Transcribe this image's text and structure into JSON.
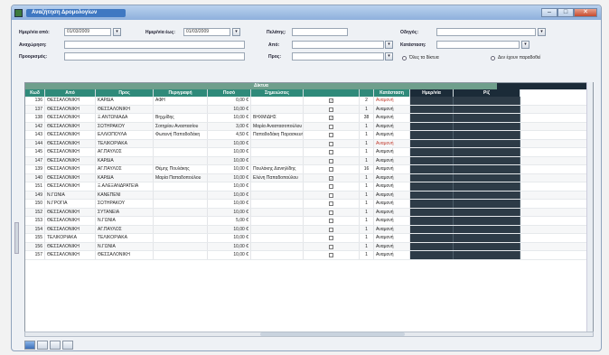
{
  "window": {
    "title": "Αναζήτηση Δρομολογίων",
    "buttons": [
      "–",
      "□",
      "✕"
    ]
  },
  "form": {
    "date_from_label": "Ημερ/νία από:",
    "date_from": "01/03/2009",
    "date_to_label": "Ημερ/νία έως:",
    "date_to": "01/03/2009",
    "departure_label": "Αναχώρηση:",
    "departure": "",
    "destination_label": "Προορισμός:",
    "destination": "",
    "client_label": "Πελάτης:",
    "client": "",
    "from_label": "Από:",
    "from": "",
    "to_label": "Προς:",
    "to": "",
    "driver_label": "Οδηγός:",
    "driver": "",
    "category_label": "Κατάσταση:",
    "category": "",
    "radio_all": "Όλες τα δίκτυα",
    "radio_other": "Δεν έχουν παραδοθεί"
  },
  "grid": {
    "group_title": "Δίκτυα",
    "columns": [
      "Κωδ",
      "Από",
      "Προς",
      "Περιγραφή",
      "Ποσό",
      "Σημειώσεις",
      "",
      "",
      "Κατάσταση",
      "Ημερ/νία",
      "Ρίζ"
    ],
    "rows": [
      {
        "id": "136",
        "from": "ΘΕΣΣΑΛΟΝΙΚΗ",
        "to": "ΚΑΡΔΙΑ",
        "desc": "ΑΦΗ",
        "amt": "0,00 €",
        "note": "",
        "chk": true,
        "qty": "2",
        "status": "Αναμονή",
        "red": true
      },
      {
        "id": "137",
        "from": "ΘΕΣΣΑΛΟΝΙΚΗ",
        "to": "ΘΕΣΣΑΛΟΝΙΚΗ",
        "desc": "",
        "amt": "10,00 €",
        "note": "",
        "chk": false,
        "qty": "1",
        "status": "Αναμονή",
        "red": false
      },
      {
        "id": "138",
        "from": "ΘΕΣΣΑΛΟΝΙΚΗ",
        "to": "Ξ.ΑΝΤΩΝΙΑΔΑ",
        "desc": "Βηχμίδης",
        "amt": "10,00 €",
        "note": "ΒΗΧΜΙΔΗΣ",
        "chk": true,
        "qty": "38",
        "status": "Αναμονή",
        "red": false
      },
      {
        "id": "142",
        "from": "ΘΕΣΣΑΛΟΝΙΚΗ",
        "to": "ΣΩΤΗΡΑΚΟΥ",
        "desc": "Σοτηρίου Αναστασίου",
        "amt": "3,00 €",
        "note": "Μαρία Αναστασοπούλου",
        "chk": false,
        "qty": "1",
        "status": "Αναμονή",
        "red": false
      },
      {
        "id": "143",
        "from": "ΘΕΣΣΑΛΟΝΙΚΗ",
        "to": "ΕΛΛΙΟΠΟΥΛΑ",
        "desc": "Φωτεινή Παπαδοδάκη",
        "amt": "4,50 €",
        "note": "Παπαδοδάκη Παρασκευή",
        "chk": false,
        "qty": "1",
        "status": "Αναμονή",
        "red": false
      },
      {
        "id": "144",
        "from": "ΘΕΣΣΑΛΟΝΙΚΗ",
        "to": "ΤΕΛΙΚΟΡΙΑΚΑ",
        "desc": "",
        "amt": "10,00 €",
        "note": "",
        "chk": false,
        "qty": "1",
        "status": "Αναμονή",
        "red": true
      },
      {
        "id": "145",
        "from": "ΘΕΣΣΑΛΟΝΙΚΗ",
        "to": "ΑΓ.ΠΑΥΛΟΣ",
        "desc": "",
        "amt": "10,00 €",
        "note": "",
        "chk": false,
        "qty": "1",
        "status": "Αναμονή",
        "red": false
      },
      {
        "id": "147",
        "from": "ΘΕΣΣΑΛΟΝΙΚΗ",
        "to": "ΚΑΡΔΙΑ",
        "desc": "",
        "amt": "10,00 €",
        "note": "",
        "chk": false,
        "qty": "1",
        "status": "Αναμονή",
        "red": false
      },
      {
        "id": "139",
        "from": "ΘΕΣΣΑΛΟΝΙΚΗ",
        "to": "ΑΓ.ΠΑΥΛΟΣ",
        "desc": "Θέμης Πουλάκης",
        "amt": "10,00 €",
        "note": "Πουλάκης Δανιηλίδης",
        "chk": false,
        "qty": "16",
        "status": "Αναμονή",
        "red": false
      },
      {
        "id": "140",
        "from": "ΘΕΣΣΑΛΟΝΙΚΗ",
        "to": "ΚΑΡΔΙΑ",
        "desc": "Μαρία Παπαδοπούλου",
        "amt": "10,00 €",
        "note": "Ελένη Παπαδοπούλου",
        "chk": true,
        "qty": "1",
        "status": "Αναμονή",
        "red": false
      },
      {
        "id": "151",
        "from": "ΘΕΣΣΑΛΟΝΙΚΗ",
        "to": "Ξ.ΑΛΕΞΑΝΔΡΑΤΕΙΑ",
        "desc": "",
        "amt": "10,00 €",
        "note": "",
        "chk": false,
        "qty": "1",
        "status": "Αναμονή",
        "red": false
      },
      {
        "id": "149",
        "from": "Ν.ΓΩΝΙΑ",
        "to": "ΚΑΝΕΠΕΝΙ",
        "desc": "",
        "amt": "10,00 €",
        "note": "",
        "chk": false,
        "qty": "1",
        "status": "Αναμονή",
        "red": false
      },
      {
        "id": "150",
        "from": "Ν.ΓΡΟΓΙΑ",
        "to": "ΣΩΤΗΡΑΚΟΥ",
        "desc": "",
        "amt": "10,00 €",
        "note": "",
        "chk": false,
        "qty": "1",
        "status": "Αναμονή",
        "red": false
      },
      {
        "id": "152",
        "from": "ΘΕΣΣΑΛΟΝΙΚΗ",
        "to": "ΣΥΤΑΝΕΙΑ",
        "desc": "",
        "amt": "10,00 €",
        "note": "",
        "chk": false,
        "qty": "1",
        "status": "Αναμονή",
        "red": false
      },
      {
        "id": "153",
        "from": "ΘΕΣΣΑΛΟΝΙΚΗ",
        "to": "Ν.ΓΩΝΙΑ",
        "desc": "",
        "amt": "5,00 €",
        "note": "",
        "chk": false,
        "qty": "1",
        "status": "Αναμονή",
        "red": false
      },
      {
        "id": "154",
        "from": "ΘΕΣΣΑΛΟΝΙΚΗ",
        "to": "ΑΓ.ΠΑΥΛΟΣ",
        "desc": "",
        "amt": "10,00 €",
        "note": "",
        "chk": false,
        "qty": "1",
        "status": "Αναμονή",
        "red": false
      },
      {
        "id": "155",
        "from": "ΤΕΛΙΚΟΡΙΑΚΑ",
        "to": "ΤΕΛΙΚΟΡΙΑΚΑ",
        "desc": "",
        "amt": "10,00 €",
        "note": "",
        "chk": false,
        "qty": "1",
        "status": "Αναμονή",
        "red": false
      },
      {
        "id": "156",
        "from": "ΘΕΣΣΑΛΟΝΙΚΗ",
        "to": "Ν.ΓΩΝΙΑ",
        "desc": "",
        "amt": "10,00 €",
        "note": "",
        "chk": false,
        "qty": "1",
        "status": "Αναμονή",
        "red": false
      },
      {
        "id": "157",
        "from": "ΘΕΣΣΑΛΟΝΙΚΗ",
        "to": "ΘΕΣΣΑΛΟΝΙΚΗ",
        "desc": "",
        "amt": "10,00 €",
        "note": "",
        "chk": false,
        "qty": "1",
        "status": "Αναμονή",
        "red": false
      }
    ]
  },
  "colors": {
    "header_teal": "#2f8a7a",
    "header_dark": "#1b2b38",
    "status_red": "#c0392b"
  }
}
